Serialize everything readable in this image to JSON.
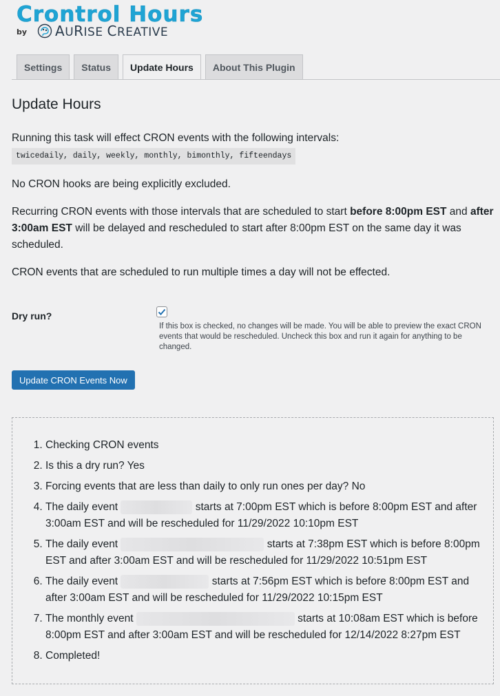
{
  "header": {
    "logo_title": "Crontrol Hours",
    "logo_by": "by",
    "brand_a": "A",
    "brand_u": "U",
    "brand_r": "R",
    "brand_ise": "ISE ",
    "brand_c": "C",
    "brand_reative": "REATIVE"
  },
  "tabs": [
    {
      "label": "Settings"
    },
    {
      "label": "Status"
    },
    {
      "label": "Update Hours",
      "active": true
    },
    {
      "label": "About This Plugin"
    }
  ],
  "page": {
    "title": "Update Hours",
    "intro": "Running this task will effect CRON events with the following intervals:",
    "intervals": "twicedaily, daily, weekly, monthly, bimonthly, fifteendays",
    "excluded": "No CRON hooks are being explicitly excluded.",
    "recurring_a": "Recurring CRON events with those intervals that are scheduled to start ",
    "recurring_b": "before 8:00pm EST",
    "recurring_c": " and ",
    "recurring_d": "after 3:00am EST",
    "recurring_e": " will be delayed and rescheduled to start after 8:00pm EST on the same day it was scheduled.",
    "multiple": "CRON events that are scheduled to run multiple times a day will not be effected."
  },
  "form": {
    "dry_run_label": "Dry run?",
    "dry_run_checked": true,
    "dry_run_desc": "If this box is checked, no changes will be made. You will be able to preview the exact CRON events that would be rescheduled. Uncheck this box and run it again for anything to be changed.",
    "submit_label": "Update CRON Events Now"
  },
  "results": {
    "i1": "Checking CRON events",
    "i2": "Is this a dry run? Yes",
    "i3": "Forcing events that are less than daily to only run ones per day? No",
    "i4a": "The daily event",
    "i4b": "starts at 7:00pm EST which is before 8:00pm EST and after 3:00am EST and will be rescheduled for 11/29/2022 10:10pm EST",
    "i5a": "The daily event",
    "i5b": "starts at 7:38pm EST which is before 8:00pm EST and after 3:00am EST and will be rescheduled for 11/29/2022 10:51pm EST",
    "i6a": "The daily event",
    "i6b": "starts at 7:56pm EST which is before 8:00pm EST and after 3:00am EST and will be rescheduled for 11/29/2022 10:15pm EST",
    "i7a": "The monthly event",
    "i7b": "starts at 10:08am EST which is before 8:00pm EST and after 3:00am EST and will be rescheduled for 12/14/2022 8:27pm EST",
    "i8": "Completed!"
  }
}
